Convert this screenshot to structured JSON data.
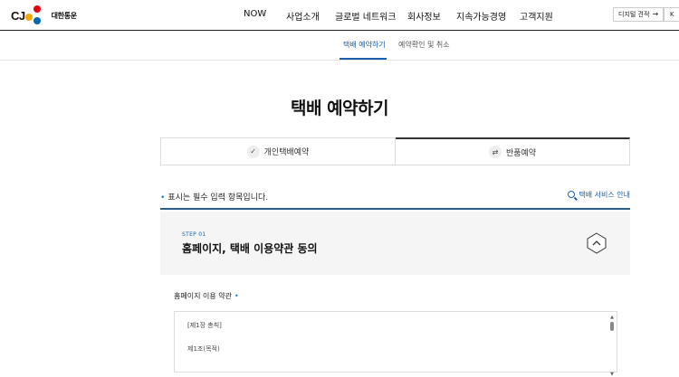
{
  "header": {
    "logo": {
      "cj": "CJ",
      "text": "대한통운"
    },
    "nav": [
      "NOW",
      "사업소개",
      "글로벌 네트워크",
      "회사정보",
      "지속가능경영",
      "고객지원"
    ],
    "digital_quote_label": "디지털 견적",
    "lang_label": "K"
  },
  "subnav": {
    "tabs": [
      "택배 예약하기",
      "예약확인 및 취소"
    ],
    "active_index": 0
  },
  "page": {
    "title": "택배 예약하기"
  },
  "reservation_types": {
    "tabs": [
      {
        "label": "개인택배예약",
        "icon": "check-icon",
        "active": false
      },
      {
        "label": "반품예약",
        "icon": "return-icon",
        "active": true
      }
    ]
  },
  "notice": {
    "star": "•",
    "required_text": "표시는 필수 입력 항목입니다.",
    "service_link": "택배 서비스 안내"
  },
  "step": {
    "label": "STEP 01",
    "title": "홈페이지, 택배 이용약관 동의"
  },
  "terms": {
    "label": "홈페이지 이용 약관",
    "star": "•",
    "lines": [
      "[제1장 총칙]",
      "제1조(목적)"
    ]
  },
  "colors": {
    "accent_blue": "#1c5fa8",
    "required_star": "#1c7ed6",
    "step_bg": "#f5f5f5"
  }
}
